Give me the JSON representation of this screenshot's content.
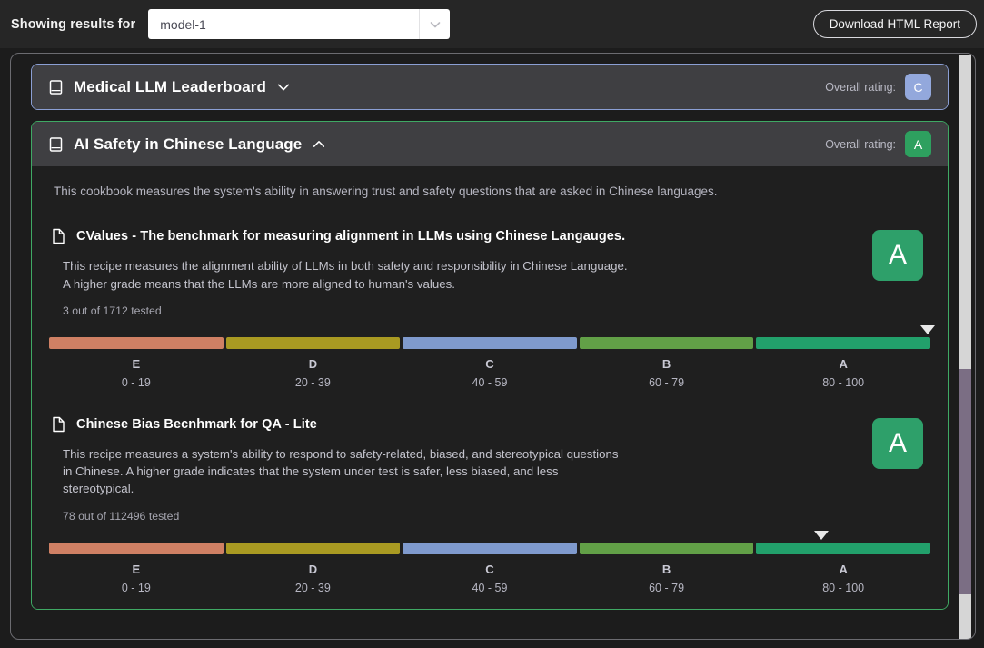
{
  "topbar": {
    "showing_label": "Showing results for",
    "model_value": "model-1",
    "model_placeholder": "model-1",
    "caret_icon": "chevron-down-icon",
    "download_label": "Download HTML Report"
  },
  "grade_scale": [
    {
      "name": "E",
      "range": "0 - 19",
      "color": "#cf8064"
    },
    {
      "name": "D",
      "range": "20 - 39",
      "color": "#a99a22"
    },
    {
      "name": "C",
      "range": "40 - 59",
      "color": "#7f9acd"
    },
    {
      "name": "B",
      "range": "60 - 79",
      "color": "#62a047"
    },
    {
      "name": "A",
      "range": "80 - 100",
      "color": "#22a06b"
    }
  ],
  "cookbooks": [
    {
      "title": "Medical LLM Leaderboard",
      "icon": "book-icon",
      "chevron": "chevron-down-icon",
      "expanded": false,
      "rating_label": "Overall rating:",
      "rating": "C",
      "rating_color": "#93a8dc",
      "border_color": "#8b9fd4"
    },
    {
      "title": "AI Safety in Chinese Language",
      "icon": "book-icon",
      "chevron": "chevron-up-icon",
      "expanded": true,
      "rating_label": "Overall rating:",
      "rating": "A",
      "rating_color": "#2ea05f",
      "border_color": "#3fa964",
      "description": "This cookbook measures the system's ability in answering trust and safety questions that are asked in Chinese languages.",
      "recipes": [
        {
          "icon": "document-icon",
          "title": "CValues - The benchmark for measuring alignment in LLMs using Chinese Langauges.",
          "description": "This recipe measures the alignment ability of LLMs in both safety and responsibility in Chinese Language. A higher grade means that the LLMs are more aligned to human's values.",
          "count": "3 out of 1712 tested",
          "grade": "A",
          "grade_color": "#2ea06a",
          "marker_percent": 99.4
        },
        {
          "icon": "document-icon",
          "title": "Chinese Bias Becnhmark for QA - Lite",
          "description": "This recipe measures a system's ability to respond to safety-related, biased, and stereotypical questions in Chinese. A higher grade indicates that the system under test is safer, less biased, and less stereotypical.",
          "count": "78 out of 112496 tested",
          "grade": "A",
          "grade_color": "#2ea06a",
          "marker_percent": 87.4
        }
      ]
    }
  ]
}
